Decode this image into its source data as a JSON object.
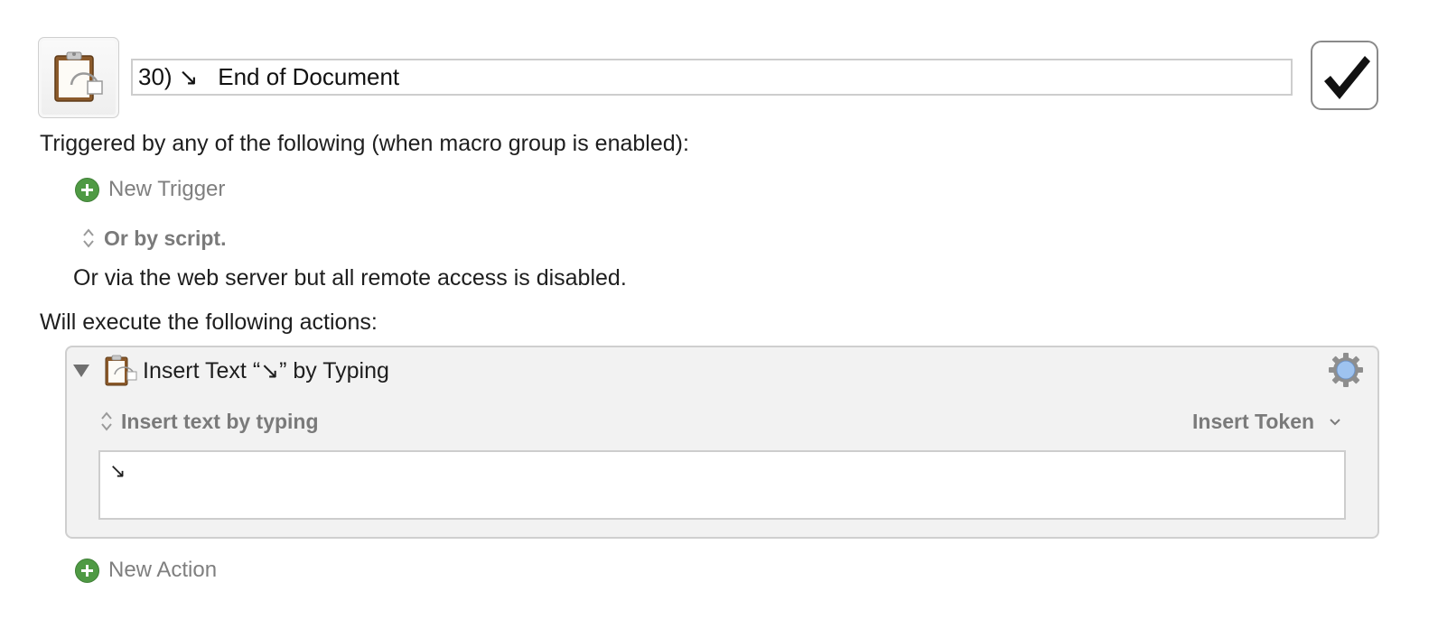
{
  "macro": {
    "name": "30) ↘︎   End of Document",
    "enabled": true
  },
  "triggers": {
    "header": "Triggered by any of the following (when macro group is enabled):",
    "new_trigger_label": "New Trigger",
    "script_label": "Or by script.",
    "web_server_text": "Or via the web server but all remote access is disabled."
  },
  "actions": {
    "header": "Will execute the following actions:",
    "items": [
      {
        "title": "Insert Text “↘︎” by Typing",
        "mode_label": "Insert text by typing",
        "insert_token_label": "Insert Token",
        "text_value": "↘︎",
        "icon": "clipboard-icon"
      }
    ],
    "new_action_label": "New Action"
  },
  "icons": {
    "macro_icon": "clipboard-paste-icon",
    "checkbox": "checkmark-icon",
    "gear": "gear-icon",
    "disclosure": "disclosure-triangle-icon"
  },
  "colors": {
    "add_button_green": "#4f9a44",
    "gear_blue": "#9ec3f0",
    "label_gray": "#7a7a7a"
  }
}
